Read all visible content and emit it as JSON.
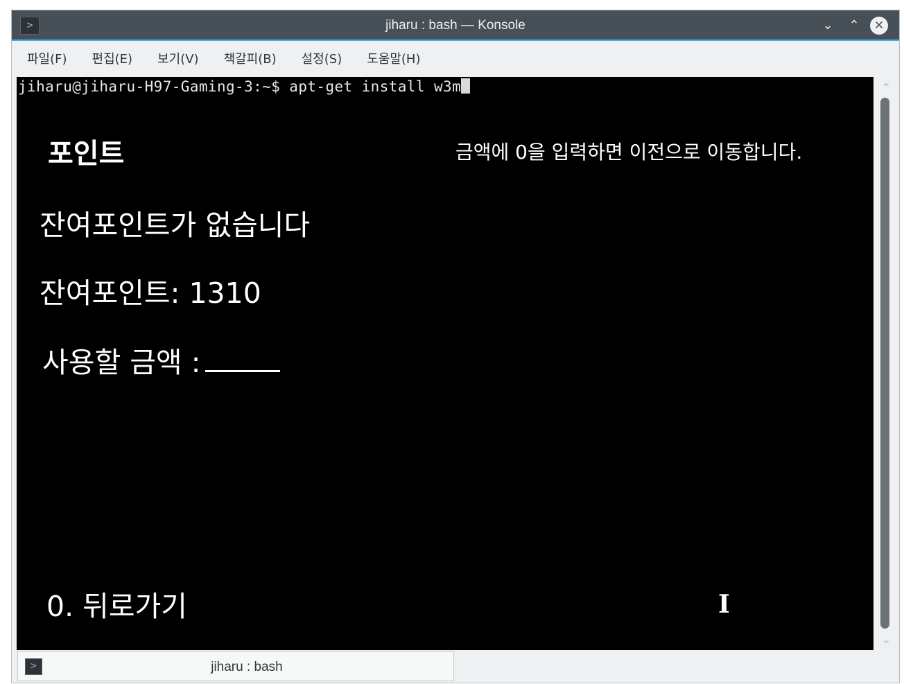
{
  "window": {
    "title": "jiharu : bash — Konsole",
    "app_icon": "terminal-icon",
    "controls": [
      "chevron-down-icon",
      "chevron-up-icon",
      "close-icon"
    ]
  },
  "menubar": {
    "items": [
      "파일(F)",
      "편집(E)",
      "보기(V)",
      "책갈피(B)",
      "설정(S)",
      "도움말(H)"
    ]
  },
  "terminal": {
    "prompt": "jiharu@jiharu-H97-Gaming-3:~$ apt-get install w3m",
    "overlay": {
      "title": "포인트",
      "hint": "금액에 0을 입력하면 이전으로 이동합니다.",
      "message": "잔여포인트가 없습니다",
      "points_line": "잔여포인트: 1310",
      "amount_label": "사용할 금액 :",
      "back_option": "0. 뒤로가기"
    }
  },
  "tabbar": {
    "tabs": [
      {
        "label": "jiharu : bash",
        "icon": "terminal-icon"
      }
    ]
  },
  "colors": {
    "titlebar": "#475057",
    "accent": "#3daee9",
    "terminal_bg": "#000000",
    "window_bg": "#eff0f1"
  }
}
